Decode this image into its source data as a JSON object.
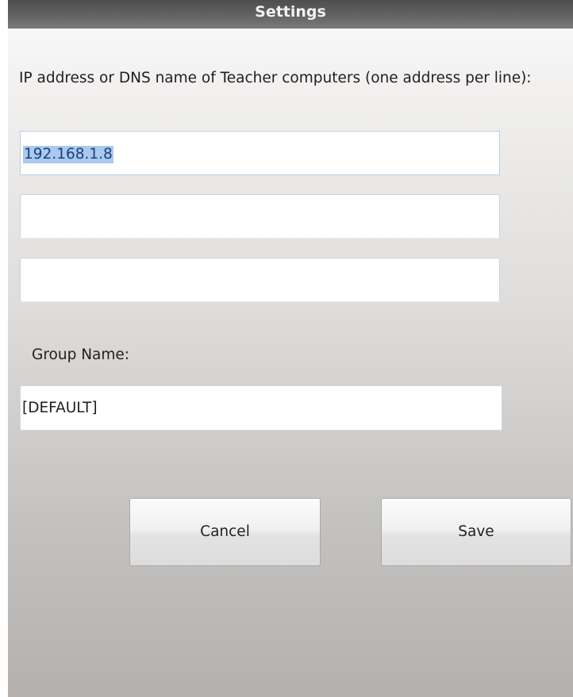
{
  "window": {
    "title": "Settings"
  },
  "teachers": {
    "label": "IP address or DNS name of Teacher computers (one address per line):",
    "addresses": [
      "192.168.1.8",
      "",
      ""
    ]
  },
  "group": {
    "label": "Group Name:",
    "value": "[DEFAULT]"
  },
  "buttons": {
    "cancel_label": "Cancel",
    "save_label": "Save"
  },
  "colors": {
    "titlebar": "#5a5a5a",
    "selection": "#a9c9ef"
  }
}
